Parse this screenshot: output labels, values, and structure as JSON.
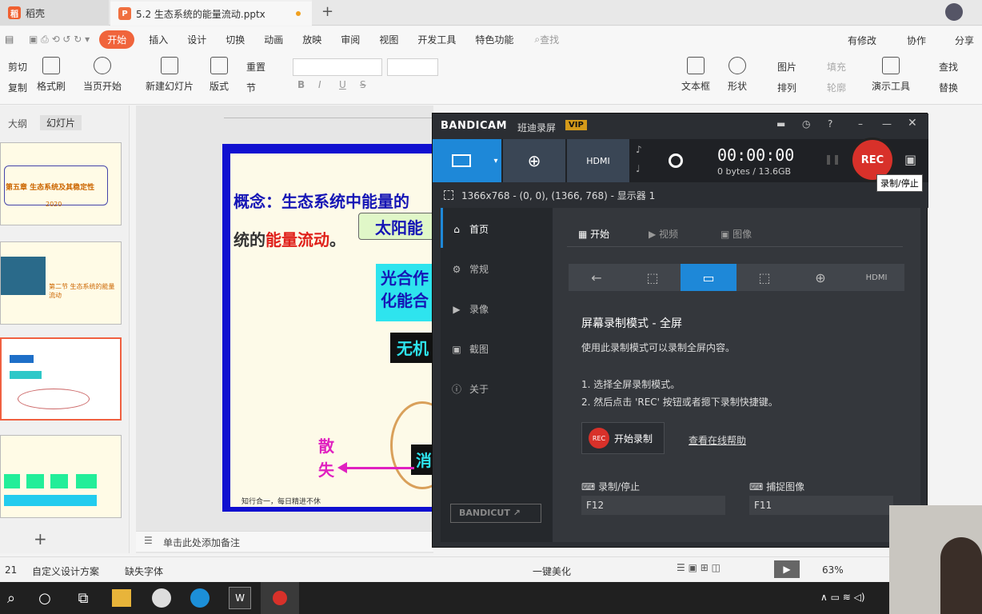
{
  "tabs": {
    "home": "稻壳",
    "file": "5.2 生态系统的能量流动.pptx",
    "new": "+"
  },
  "menu": [
    "开始",
    "插入",
    "设计",
    "切换",
    "动画",
    "放映",
    "审阅",
    "视图",
    "开发工具",
    "特色功能"
  ],
  "menu_search": "查找",
  "menu_right": [
    "有修改",
    "协作",
    "分享"
  ],
  "ribbon": {
    "cut": "剪切",
    "copy": "复制",
    "format_painter": "格式刷",
    "from_current": "当页开始",
    "new_slide": "新建幻灯片",
    "layout": "版式",
    "reset": "重置",
    "section": "节",
    "textbox": "文本框",
    "shape": "形状",
    "picture": "图片",
    "arrange": "排列",
    "fill": "填充",
    "outline": "轮廓",
    "presentation_tools": "演示工具",
    "find": "查找",
    "replace": "替换",
    "bold": "B",
    "italic": "I",
    "underline": "U",
    "strike": "S"
  },
  "panel": {
    "outline_tab": "大纲",
    "slides_tab": "幻灯片",
    "add": "+"
  },
  "thumbs": [
    {
      "title": "第五章 生态系统及其稳定性",
      "sub": "2020"
    },
    {
      "title": "第二节 生态系统的能量流动"
    },
    {
      "title": ""
    },
    {
      "title": ""
    }
  ],
  "slide": {
    "line1_prefix": "概念：生态系统中能量的",
    "line2_prefix": "统的",
    "line2_red": "能量流动",
    "line2_suffix": "。",
    "sun_box": "太阳能",
    "cyan_line1": "光合作",
    "cyan_line2": "化能合",
    "black_box": "无机",
    "black_box2": "消",
    "scatter1": "散",
    "scatter2": "失",
    "footer": "知行合一，每日精进不休"
  },
  "notes_placeholder": "单击此处添加备注",
  "status": {
    "slide_num": "21",
    "custom_design": "自定义设计方案",
    "missing_font": "缺失字体",
    "beautify": "一键美化",
    "zoom": "63%"
  },
  "bandicam": {
    "logo": "BANDICAM",
    "brand_cn": "班迪录屏",
    "vip": "VIP",
    "timer": "00:00:00",
    "size": "0 bytes / 13.6GB",
    "rec": "REC",
    "tooltip": "录制/停止",
    "area": "1366x768 - (0, 0), (1366, 768) - 显示器 1",
    "sidebar": [
      "首页",
      "常规",
      "录像",
      "截图",
      "关于"
    ],
    "bandicut": "BANDICUT",
    "subtabs": [
      "开始",
      "视频",
      "图像"
    ],
    "mode_title": "屏幕录制模式 - 全屏",
    "mode_desc": "使用此录制模式可以录制全屏内容。",
    "step1": "1. 选择全屏录制模式。",
    "step2": "2. 然后点击 'REC' 按钮或者摁下录制快捷键。",
    "start_btn": "开始录制",
    "start_rec_icon": "REC",
    "help_link": "查看在线帮助",
    "hotkey_rec_label": "录制/停止",
    "hotkey_rec_value": "F12",
    "hotkey_cap_label": "捕捉图像",
    "hotkey_cap_value": "F11"
  },
  "colors": {
    "accent": "#f0643c",
    "bandi_bg": "#2b2e33",
    "bandi_blue": "#1e88d8",
    "rec_red": "#d8312a",
    "slide_border": "#1010d0"
  }
}
